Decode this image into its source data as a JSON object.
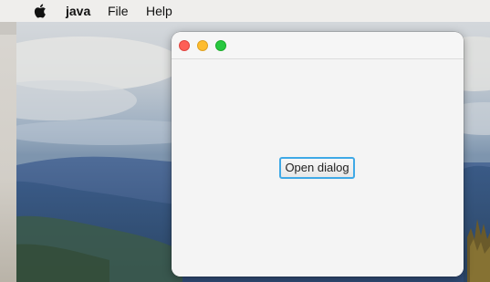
{
  "menubar": {
    "apple_icon": "apple-icon",
    "app_name": "java",
    "items": [
      "File",
      "Help"
    ]
  },
  "window": {
    "controls": [
      "close",
      "minimize",
      "zoom"
    ],
    "colors": {
      "close": "#fe5f57",
      "minimize": "#febc2e",
      "zoom": "#28c840"
    }
  },
  "content": {
    "open_dialog_label": "Open dialog",
    "focus_ring_color": "#3fa9e6"
  }
}
